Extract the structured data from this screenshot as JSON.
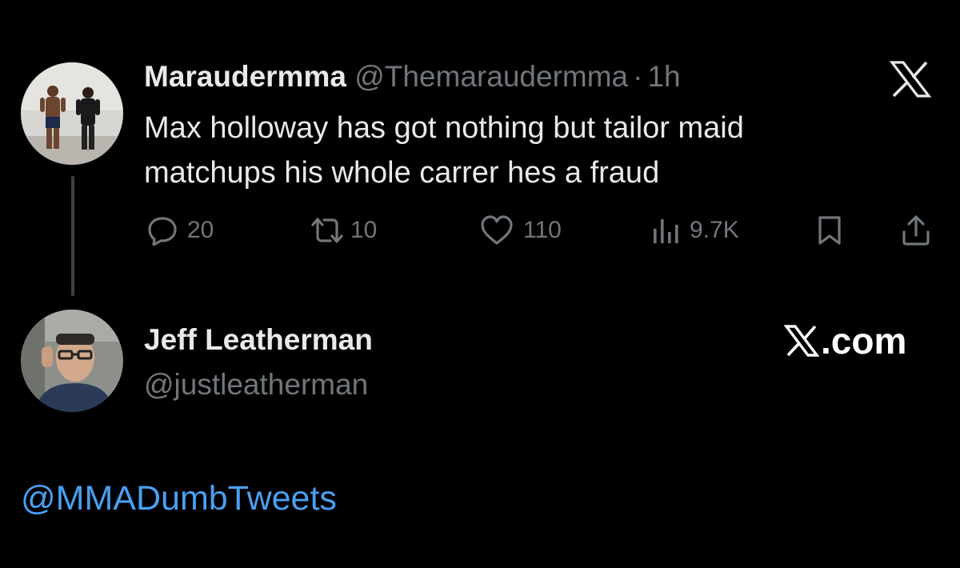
{
  "tweet": {
    "display_name": "Maraudermma",
    "handle": "@Themaraudermma",
    "separator": "·",
    "time": "1h",
    "text_line1": "Max holloway has got nothing but tailor maid",
    "text_line2": "matchups his whole carrer hes a fraud",
    "replies": "20",
    "reposts": "10",
    "likes": "110",
    "views": "9.7K",
    "platform_icon": "x-logo-icon"
  },
  "reply": {
    "display_name": "Jeff Leatherman",
    "handle": "@justleatherman",
    "watermark": ".com"
  },
  "caption": {
    "mention": "@MMADumbTweets"
  },
  "colors": {
    "background": "#000000",
    "primary_text": "#e7e9ea",
    "secondary_text": "#71767b",
    "mention": "#4a9ff0",
    "thread_line": "#3e4144"
  }
}
